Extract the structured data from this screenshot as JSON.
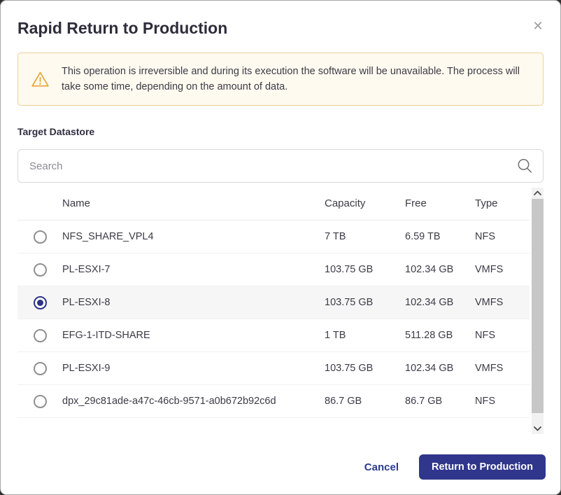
{
  "modal": {
    "title": "Rapid Return to Production"
  },
  "icons": {
    "close": "✕"
  },
  "warning": {
    "text": "This operation is irreversible and during its execution the software will be unavailable. The process will take some time, depending on the amount of data."
  },
  "target_datastore": {
    "label": "Target Datastore",
    "search_placeholder": "Search",
    "search_value": ""
  },
  "table": {
    "columns": [
      "Name",
      "Capacity",
      "Free",
      "Type"
    ],
    "rows": [
      {
        "name": "NFS_SHARE_VPL4",
        "capacity": "7 TB",
        "free": "6.59 TB",
        "type": "NFS",
        "selected": false
      },
      {
        "name": "PL-ESXI-7",
        "capacity": "103.75 GB",
        "free": "102.34 GB",
        "type": "VMFS",
        "selected": false
      },
      {
        "name": "PL-ESXI-8",
        "capacity": "103.75 GB",
        "free": "102.34 GB",
        "type": "VMFS",
        "selected": true
      },
      {
        "name": "EFG-1-ITD-SHARE",
        "capacity": "1 TB",
        "free": "511.28 GB",
        "type": "NFS",
        "selected": false
      },
      {
        "name": "PL-ESXI-9",
        "capacity": "103.75 GB",
        "free": "102.34 GB",
        "type": "VMFS",
        "selected": false
      },
      {
        "name": "dpx_29c81ade-a47c-46cb-9571-a0b672b92c6d",
        "capacity": "86.7 GB",
        "free": "86.7 GB",
        "type": "NFS",
        "selected": false
      }
    ]
  },
  "footer": {
    "cancel_label": "Cancel",
    "submit_label": "Return to Production"
  },
  "colors": {
    "accent": "#2f368b",
    "radio_selected": "#2b3385",
    "warning_bg": "#fefaef",
    "warning_border": "#ecd092",
    "warning_icon": "#e9a83f",
    "selected_row_bg": "#f6f6f6"
  }
}
